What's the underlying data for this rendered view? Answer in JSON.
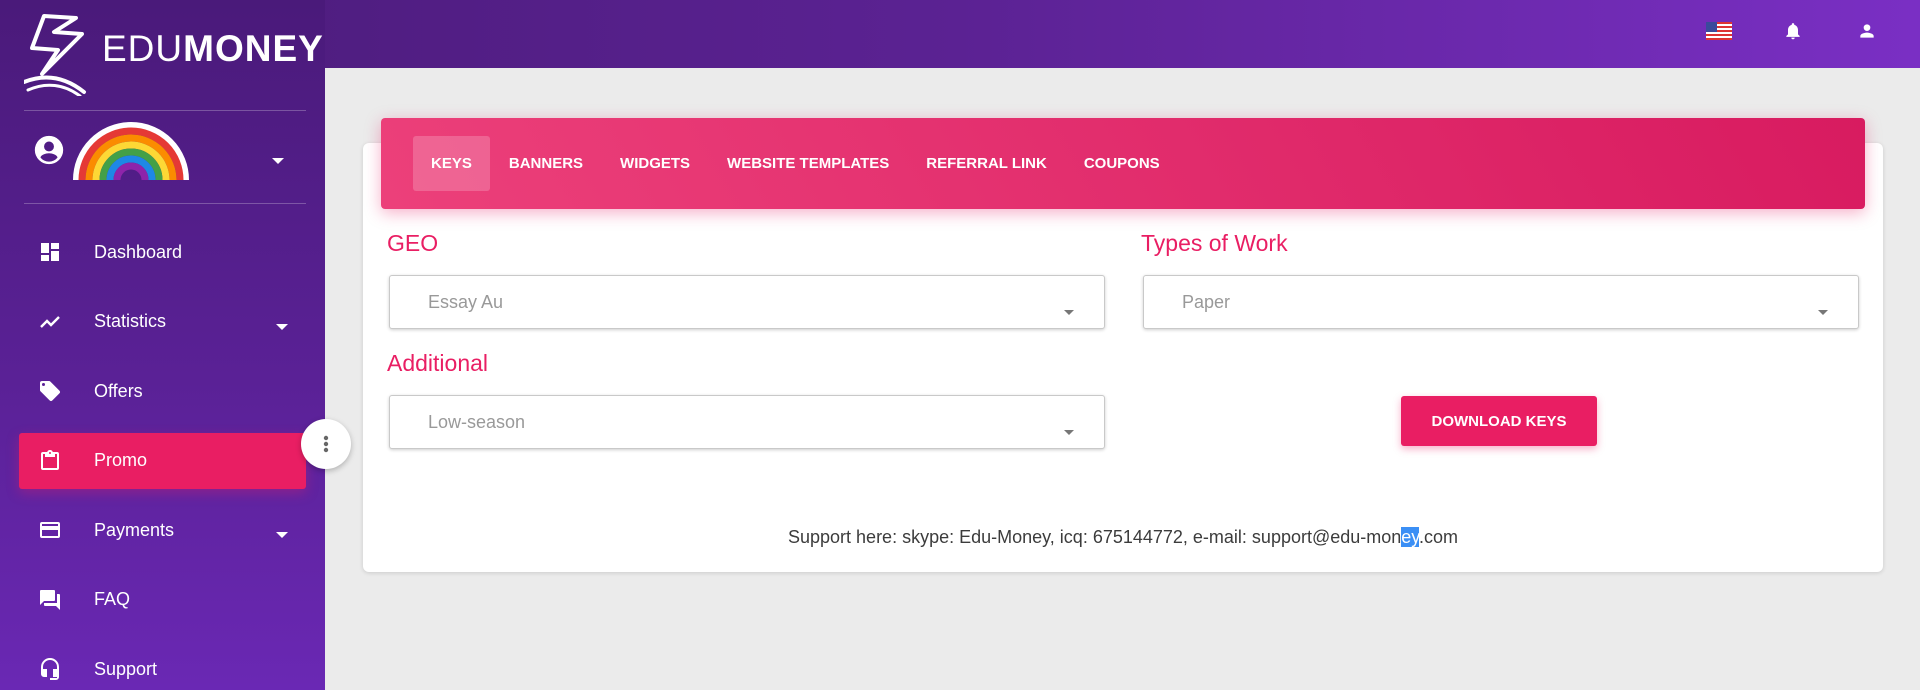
{
  "brand": {
    "part1": "EDU",
    "part2": "MONEY"
  },
  "topbar": {
    "icons": [
      "us-flag-icon",
      "bell-icon",
      "user-icon"
    ]
  },
  "sidebar": {
    "items": [
      {
        "label": "Dashboard",
        "icon": "dashboard-icon",
        "has_caret": false
      },
      {
        "label": "Statistics",
        "icon": "trending-icon",
        "has_caret": true
      },
      {
        "label": "Offers",
        "icon": "tag-icon",
        "has_caret": false
      },
      {
        "label": "Promo",
        "icon": "clipboard-icon",
        "has_caret": false,
        "active": true
      },
      {
        "label": "Payments",
        "icon": "credit-card-icon",
        "has_caret": true
      },
      {
        "label": "FAQ",
        "icon": "forum-icon",
        "has_caret": false
      },
      {
        "label": "Support",
        "icon": "headset-icon",
        "has_caret": false
      }
    ]
  },
  "tabs": [
    {
      "label": "KEYS",
      "active": true
    },
    {
      "label": "BANNERS"
    },
    {
      "label": "WIDGETS"
    },
    {
      "label": "WEBSITE TEMPLATES"
    },
    {
      "label": "REFERRAL LINK"
    },
    {
      "label": "COUPONS"
    }
  ],
  "form": {
    "geo": {
      "label": "GEO",
      "value": "Essay Au"
    },
    "types": {
      "label": "Types of Work",
      "value": "Paper"
    },
    "additional": {
      "label": "Additional",
      "value": "Low-season"
    },
    "download_label": "DOWNLOAD KEYS"
  },
  "support": {
    "before": "Support here: skype: Edu-Money, icq: 675144772, e-mail: support@edu-mon",
    "highlight": "ey",
    "after": ".com"
  },
  "colors": {
    "accent": "#e91e63",
    "sidebar": "#5a2196",
    "topbar": "#5b2293"
  }
}
